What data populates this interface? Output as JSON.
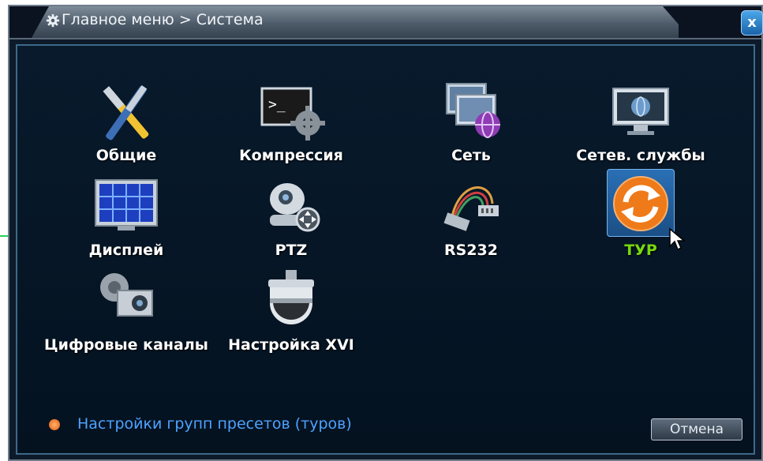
{
  "window": {
    "title": "Главное меню > Система",
    "close_label": "x"
  },
  "items": [
    {
      "label": "Общие",
      "icon": "tools-icon"
    },
    {
      "label": "Компрессия",
      "icon": "terminal-gear-icon"
    },
    {
      "label": "Сеть",
      "icon": "network-monitors-icon"
    },
    {
      "label": "Сетев. службы",
      "icon": "globe-monitor-icon"
    },
    {
      "label": "Дисплей",
      "icon": "display-grid-icon"
    },
    {
      "label": "PTZ",
      "icon": "ptz-camera-icon"
    },
    {
      "label": "RS232",
      "icon": "serial-cable-icon"
    },
    {
      "label": "ТУР",
      "icon": "refresh-icon",
      "active": true
    },
    {
      "label": "Цифровые каналы",
      "icon": "digital-camera-icon"
    },
    {
      "label": "Настройка XVI",
      "icon": "dome-camera-icon"
    }
  ],
  "info_text": "Настройки групп пресетов (туров)",
  "cancel_label": "Отмена",
  "colors": {
    "active_label": "#77d80e",
    "info_text": "#4fa2ff",
    "panel_bg": "#041220"
  }
}
